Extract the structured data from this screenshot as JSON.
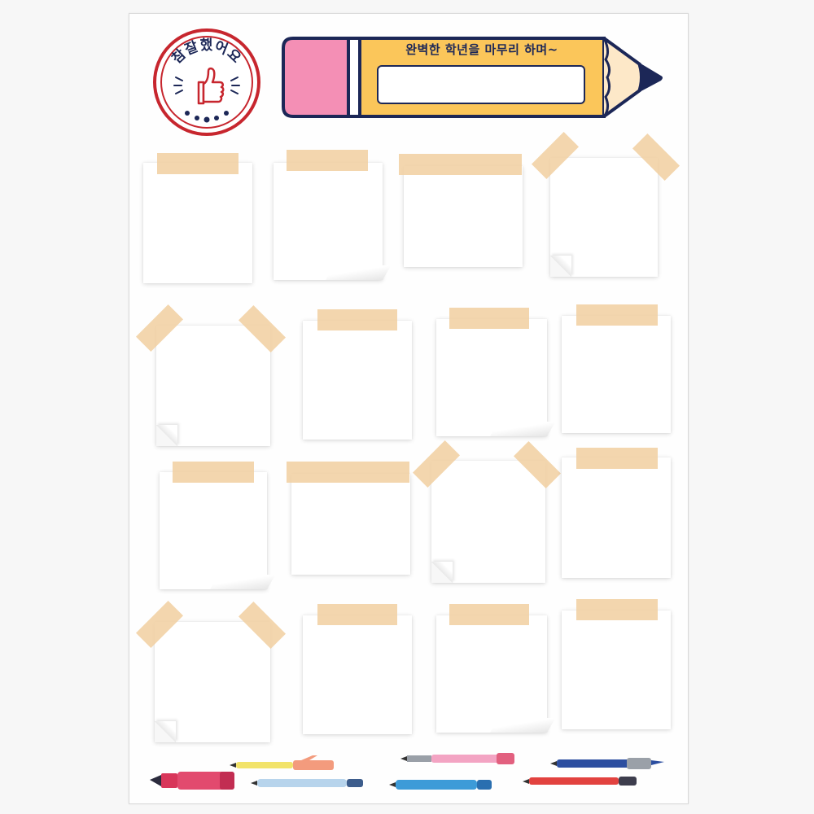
{
  "stamp": {
    "text": "참잘했어요",
    "icon": "thumbs-up-icon",
    "colors": {
      "ring": "#c7262e",
      "text": "#1c2757",
      "hand": "#c7262e"
    }
  },
  "pencil": {
    "caption": "완벽한 학년을 마무리 하며~",
    "icon": "pencil-icon",
    "colors": {
      "body": "#fbc65a",
      "eraser": "#f48fb5",
      "outline": "#1c2757"
    }
  },
  "notes_grid": {
    "rows": 4,
    "columns": 4,
    "tape_color": "#f1cfa0"
  },
  "pens": [
    "highlighter-icon",
    "pen-icon",
    "pen-icon",
    "pen-icon",
    "pen-icon",
    "pen-icon",
    "pen-icon"
  ]
}
